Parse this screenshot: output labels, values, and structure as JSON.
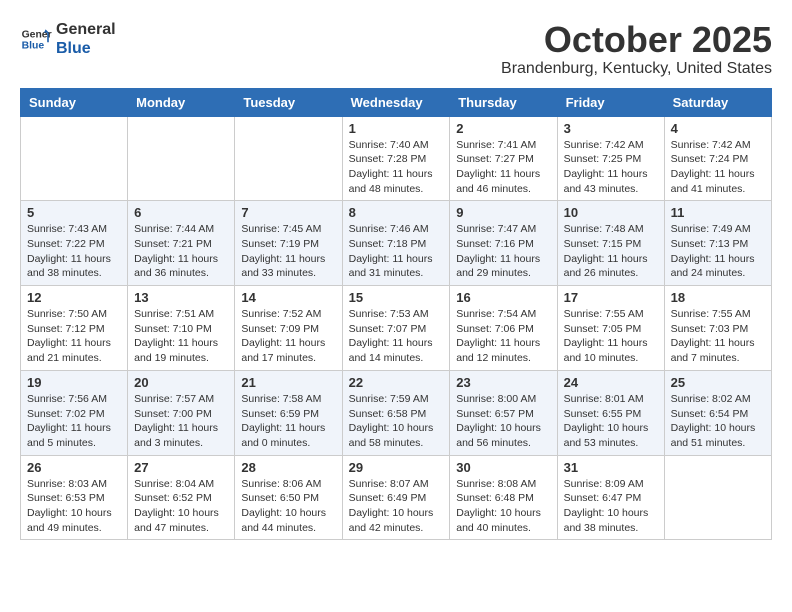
{
  "header": {
    "logo_line1": "General",
    "logo_line2": "Blue",
    "month": "October 2025",
    "location": "Brandenburg, Kentucky, United States"
  },
  "days_of_week": [
    "Sunday",
    "Monday",
    "Tuesday",
    "Wednesday",
    "Thursday",
    "Friday",
    "Saturday"
  ],
  "weeks": [
    [
      {
        "day": "",
        "info": ""
      },
      {
        "day": "",
        "info": ""
      },
      {
        "day": "",
        "info": ""
      },
      {
        "day": "1",
        "info": "Sunrise: 7:40 AM\nSunset: 7:28 PM\nDaylight: 11 hours and 48 minutes."
      },
      {
        "day": "2",
        "info": "Sunrise: 7:41 AM\nSunset: 7:27 PM\nDaylight: 11 hours and 46 minutes."
      },
      {
        "day": "3",
        "info": "Sunrise: 7:42 AM\nSunset: 7:25 PM\nDaylight: 11 hours and 43 minutes."
      },
      {
        "day": "4",
        "info": "Sunrise: 7:42 AM\nSunset: 7:24 PM\nDaylight: 11 hours and 41 minutes."
      }
    ],
    [
      {
        "day": "5",
        "info": "Sunrise: 7:43 AM\nSunset: 7:22 PM\nDaylight: 11 hours and 38 minutes."
      },
      {
        "day": "6",
        "info": "Sunrise: 7:44 AM\nSunset: 7:21 PM\nDaylight: 11 hours and 36 minutes."
      },
      {
        "day": "7",
        "info": "Sunrise: 7:45 AM\nSunset: 7:19 PM\nDaylight: 11 hours and 33 minutes."
      },
      {
        "day": "8",
        "info": "Sunrise: 7:46 AM\nSunset: 7:18 PM\nDaylight: 11 hours and 31 minutes."
      },
      {
        "day": "9",
        "info": "Sunrise: 7:47 AM\nSunset: 7:16 PM\nDaylight: 11 hours and 29 minutes."
      },
      {
        "day": "10",
        "info": "Sunrise: 7:48 AM\nSunset: 7:15 PM\nDaylight: 11 hours and 26 minutes."
      },
      {
        "day": "11",
        "info": "Sunrise: 7:49 AM\nSunset: 7:13 PM\nDaylight: 11 hours and 24 minutes."
      }
    ],
    [
      {
        "day": "12",
        "info": "Sunrise: 7:50 AM\nSunset: 7:12 PM\nDaylight: 11 hours and 21 minutes."
      },
      {
        "day": "13",
        "info": "Sunrise: 7:51 AM\nSunset: 7:10 PM\nDaylight: 11 hours and 19 minutes."
      },
      {
        "day": "14",
        "info": "Sunrise: 7:52 AM\nSunset: 7:09 PM\nDaylight: 11 hours and 17 minutes."
      },
      {
        "day": "15",
        "info": "Sunrise: 7:53 AM\nSunset: 7:07 PM\nDaylight: 11 hours and 14 minutes."
      },
      {
        "day": "16",
        "info": "Sunrise: 7:54 AM\nSunset: 7:06 PM\nDaylight: 11 hours and 12 minutes."
      },
      {
        "day": "17",
        "info": "Sunrise: 7:55 AM\nSunset: 7:05 PM\nDaylight: 11 hours and 10 minutes."
      },
      {
        "day": "18",
        "info": "Sunrise: 7:55 AM\nSunset: 7:03 PM\nDaylight: 11 hours and 7 minutes."
      }
    ],
    [
      {
        "day": "19",
        "info": "Sunrise: 7:56 AM\nSunset: 7:02 PM\nDaylight: 11 hours and 5 minutes."
      },
      {
        "day": "20",
        "info": "Sunrise: 7:57 AM\nSunset: 7:00 PM\nDaylight: 11 hours and 3 minutes."
      },
      {
        "day": "21",
        "info": "Sunrise: 7:58 AM\nSunset: 6:59 PM\nDaylight: 11 hours and 0 minutes."
      },
      {
        "day": "22",
        "info": "Sunrise: 7:59 AM\nSunset: 6:58 PM\nDaylight: 10 hours and 58 minutes."
      },
      {
        "day": "23",
        "info": "Sunrise: 8:00 AM\nSunset: 6:57 PM\nDaylight: 10 hours and 56 minutes."
      },
      {
        "day": "24",
        "info": "Sunrise: 8:01 AM\nSunset: 6:55 PM\nDaylight: 10 hours and 53 minutes."
      },
      {
        "day": "25",
        "info": "Sunrise: 8:02 AM\nSunset: 6:54 PM\nDaylight: 10 hours and 51 minutes."
      }
    ],
    [
      {
        "day": "26",
        "info": "Sunrise: 8:03 AM\nSunset: 6:53 PM\nDaylight: 10 hours and 49 minutes."
      },
      {
        "day": "27",
        "info": "Sunrise: 8:04 AM\nSunset: 6:52 PM\nDaylight: 10 hours and 47 minutes."
      },
      {
        "day": "28",
        "info": "Sunrise: 8:06 AM\nSunset: 6:50 PM\nDaylight: 10 hours and 44 minutes."
      },
      {
        "day": "29",
        "info": "Sunrise: 8:07 AM\nSunset: 6:49 PM\nDaylight: 10 hours and 42 minutes."
      },
      {
        "day": "30",
        "info": "Sunrise: 8:08 AM\nSunset: 6:48 PM\nDaylight: 10 hours and 40 minutes."
      },
      {
        "day": "31",
        "info": "Sunrise: 8:09 AM\nSunset: 6:47 PM\nDaylight: 10 hours and 38 minutes."
      },
      {
        "day": "",
        "info": ""
      }
    ]
  ]
}
